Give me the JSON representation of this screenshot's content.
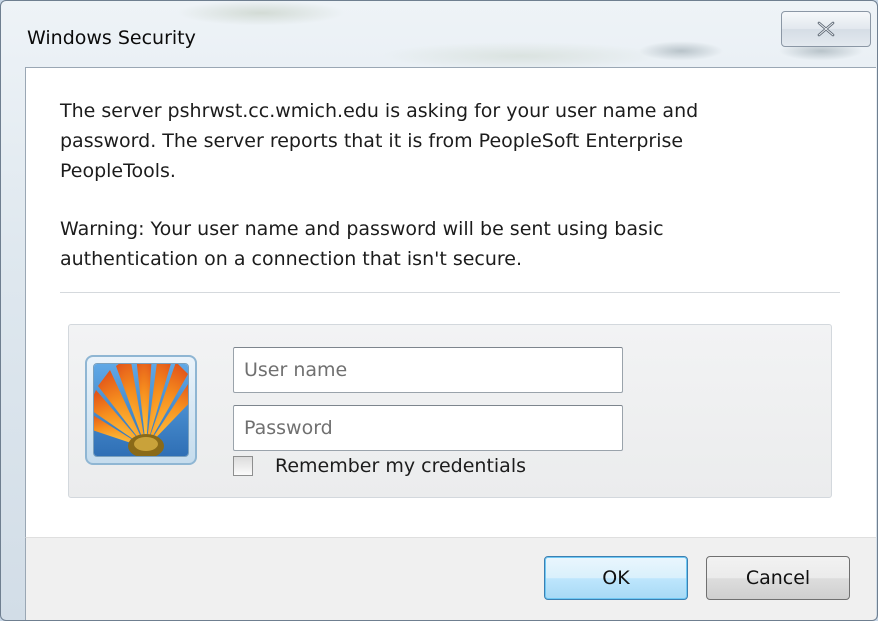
{
  "window": {
    "title": "Windows Security"
  },
  "message": {
    "server_text": "The server pshrwst.cc.wmich.edu is asking for your user name and\npassword. The server reports that it is from PeopleSoft Enterprise\nPeopleTools.",
    "warning_text": "Warning: Your user name and password will be sent using basic\nauthentication on a connection that isn't secure."
  },
  "credentials": {
    "username_placeholder": "User name",
    "password_placeholder": "Password",
    "remember_label": "Remember my credentials",
    "remember_checked": false
  },
  "buttons": {
    "ok_label": "OK",
    "cancel_label": "Cancel"
  },
  "icons": {
    "close": "close-icon",
    "avatar": "user-avatar-flower"
  },
  "colors": {
    "ok_border": "#3c7fb1",
    "ok_fill": "#bee6fd",
    "content_bg": "#ffffff",
    "footer_bg": "#f0f0f0"
  }
}
